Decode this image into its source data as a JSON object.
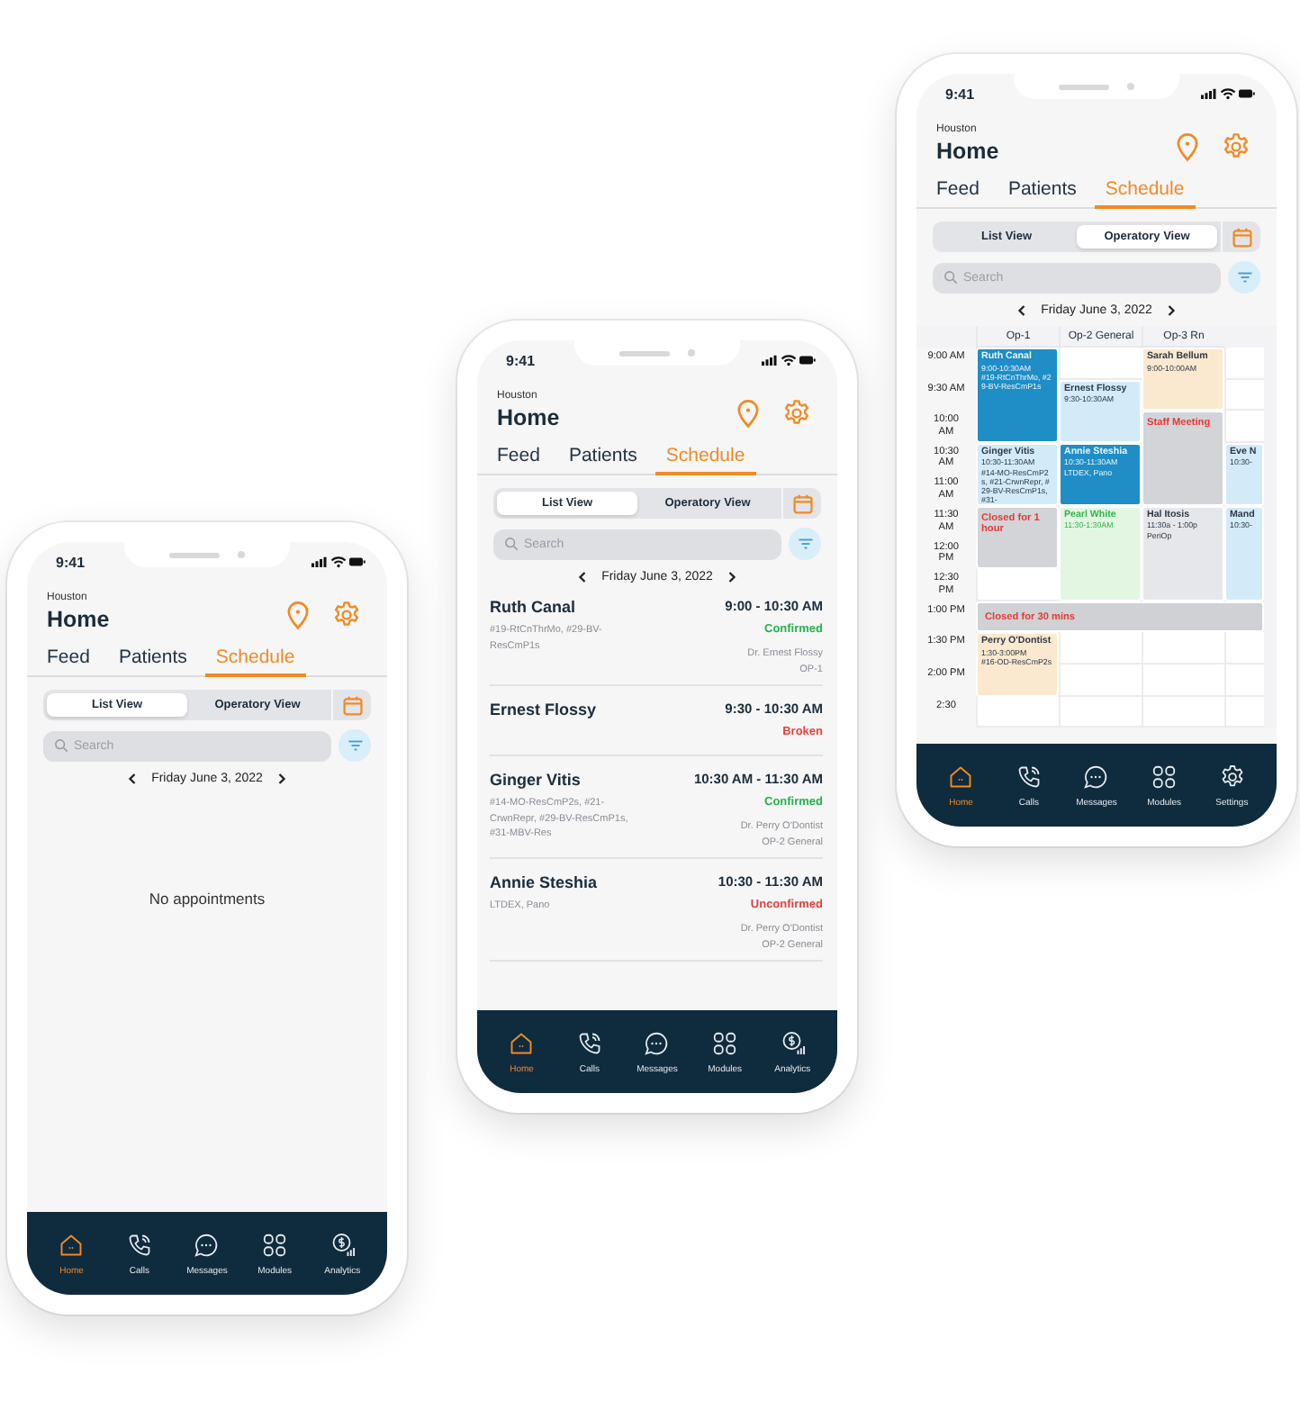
{
  "phones": [
    {
      "status_time": "9:41",
      "location": "Houston",
      "title": "Home",
      "tabs": [
        {
          "label": "Feed",
          "selected": false
        },
        {
          "label": "Patients",
          "selected": false
        },
        {
          "label": "Schedule",
          "selected": true
        }
      ],
      "views": [
        {
          "label": "List View",
          "selected": true
        },
        {
          "label": "Operatory View",
          "selected": false
        }
      ],
      "search": {
        "placeholder": "Search"
      },
      "date": "Friday June 3, 2022",
      "content": {
        "kind": "empty",
        "message": "No appointments"
      },
      "nav": [
        {
          "label": "Home",
          "kind": "home",
          "selected": true
        },
        {
          "label": "Calls",
          "kind": "calls",
          "selected": false
        },
        {
          "label": "Messages",
          "kind": "messages",
          "selected": false
        },
        {
          "label": "Modules",
          "kind": "modules",
          "selected": false
        },
        {
          "label": "Analytics",
          "kind": "analytics",
          "selected": false
        }
      ]
    },
    {
      "status_time": "9:41",
      "location": "Houston",
      "title": "Home",
      "tabs": [
        {
          "label": "Feed",
          "selected": false
        },
        {
          "label": "Patients",
          "selected": false
        },
        {
          "label": "Schedule",
          "selected": true
        }
      ],
      "views": [
        {
          "label": "List View",
          "selected": true
        },
        {
          "label": "Operatory View",
          "selected": false
        }
      ],
      "search": {
        "placeholder": "Search"
      },
      "date": "Friday June 3, 2022",
      "content": {
        "kind": "list",
        "appointments": [
          {
            "name": "Ruth Canal",
            "time": "9:00 - 10:30 AM",
            "details": "#19-RtCnThrMo, #29-BV-ResCmP1s",
            "status": "Confirmed",
            "color": "#22b34a",
            "provider": "Dr. Ernest Flossy",
            "op": "OP-1"
          },
          {
            "name": "Ernest Flossy",
            "time": "9:30 - 10:30 AM",
            "status": "Broken",
            "color": "#e5413a"
          },
          {
            "name": "Ginger Vitis",
            "time": "10:30 AM - 11:30 AM",
            "details": "#14-MO-ResCmP2s, #21-CrwnRepr, #29-BV-ResCmP1s, #31-MBV-Res",
            "status": "Confirmed",
            "color": "#22b34a",
            "provider": "Dr. Perry O'Dontist",
            "op": "OP-2 General"
          },
          {
            "name": "Annie Steshia",
            "time": "10:30 - 11:30 AM",
            "details": "LTDEX, Pano",
            "status": "Unconfirmed",
            "color": "#e5413a",
            "provider": "Dr. Perry O'Dontist",
            "op": "OP-2 General"
          }
        ]
      },
      "nav": [
        {
          "label": "Home",
          "kind": "home",
          "selected": true
        },
        {
          "label": "Calls",
          "kind": "calls",
          "selected": false
        },
        {
          "label": "Messages",
          "kind": "messages",
          "selected": false
        },
        {
          "label": "Modules",
          "kind": "modules",
          "selected": false
        },
        {
          "label": "Analytics",
          "kind": "analytics",
          "selected": false
        }
      ]
    },
    {
      "status_time": "9:41",
      "location": "Houston",
      "title": "Home",
      "tabs": [
        {
          "label": "Feed",
          "selected": false
        },
        {
          "label": "Patients",
          "selected": false
        },
        {
          "label": "Schedule",
          "selected": true
        }
      ],
      "views": [
        {
          "label": "List View",
          "selected": false
        },
        {
          "label": "Operatory View",
          "selected": true
        }
      ],
      "search": {
        "placeholder": "Search"
      },
      "date": "Friday June 3, 2022",
      "content": {
        "kind": "grid",
        "columns": [
          "Op-1",
          "Op-2 General",
          "Op-3 Rn"
        ],
        "rows": [
          {
            "time": "9:00 AM",
            "cells": [
              {
                "kind": "highlighted",
                "color": "#1f8dc6",
                "name": "Ruth Canal",
                "time": "9:00-10:30AM",
                "details": "#19-RtCnThrMo, #29-BV-ResCmP1s"
              },
              {
                "kind": "empty"
              },
              {
                "kind": "appointment",
                "color": "#fbe9cf",
                "name": "Sarah Bellum",
                "time": "9:00-10:00AM"
              },
              {
                "kind": "empty"
              }
            ]
          },
          {
            "time": "9:30 AM",
            "cells": [
              {
                "kind": "continued"
              },
              {
                "kind": "appointment",
                "color": "#d3ebf8",
                "name": "Ernest Flossy",
                "time": "9:30-10:30AM"
              },
              {
                "kind": "continued"
              },
              {
                "kind": "empty"
              }
            ]
          },
          {
            "time": "10:00 AM",
            "cells": [
              {
                "kind": "continued"
              },
              {
                "kind": "continued"
              },
              {
                "kind": "closed",
                "color": "#d2d4d8",
                "name": "Staff Meeting"
              },
              {
                "kind": "empty"
              }
            ]
          },
          {
            "time": "10:30 AM",
            "cells": [
              {
                "kind": "appointment",
                "color": "#d3ebf8",
                "name": "Ginger Vitis",
                "time": "10:30-11:30AM",
                "details": "#14-MO-ResCmP2s, #21-CrwnRepr, #29-BV-ResCmP1s, #31-"
              },
              {
                "kind": "highlighted",
                "color": "#1f8dc6",
                "name": "Annie Steshia",
                "time": "10:30-11:30AM",
                "details": "LTDEX, Pano"
              },
              {
                "kind": "continued"
              },
              {
                "kind": "appointment",
                "color": "#d3ebf8",
                "name": "Eve N",
                "time": "10:30-"
              }
            ]
          },
          {
            "time": "11:00 AM",
            "cells": [
              {
                "kind": "continued"
              },
              {
                "kind": "continued"
              },
              {
                "kind": "continued"
              },
              {
                "kind": "continued"
              }
            ]
          },
          {
            "time": "11:30 AM",
            "cells": [
              {
                "kind": "closed",
                "color": "#d2d4d8",
                "name": "Closed for 1 hour"
              },
              {
                "kind": "new",
                "color": "#e2f6e2",
                "name": "Pearl White",
                "time": "11:30-1:30AM"
              },
              {
                "kind": "appointment",
                "color": "#e6e7ea",
                "name": "Hal Itosis",
                "time": "11:30a - 1:00p",
                "details": "PeriOp"
              },
              {
                "kind": "appointment",
                "color": "#d3ebf8",
                "name": "Mand",
                "time": "10:30-"
              }
            ]
          },
          {
            "time": "12:00 PM",
            "cells": [
              {
                "kind": "continued"
              },
              {
                "kind": "continued"
              },
              {
                "kind": "continued"
              },
              {
                "kind": "continued"
              }
            ]
          },
          {
            "time": "12:30 PM",
            "cells": [
              {
                "kind": "empty"
              },
              {
                "kind": "continued"
              },
              {
                "kind": "continued"
              },
              {
                "kind": "continued"
              }
            ]
          },
          {
            "time": "1:00 PM",
            "cells": [
              {
                "kind": "closed",
                "color": "#cfd1d5",
                "name": "Closed for 30 mins",
                "across": true
              }
            ]
          },
          {
            "time": "1:30 PM",
            "cells": [
              {
                "kind": "appointment",
                "color": "#fbe9cf",
                "name": "Perry O'Dontist",
                "time": "1:30-3:00PM",
                "details": "#16-OD-ResCmP2s"
              },
              {
                "kind": "empty"
              },
              {
                "kind": "empty"
              },
              {
                "kind": "empty"
              }
            ]
          },
          {
            "time": "2:00 PM",
            "cells": [
              {
                "kind": "continued"
              },
              {
                "kind": "empty"
              },
              {
                "kind": "empty"
              },
              {
                "kind": "empty"
              }
            ]
          },
          {
            "time": "2:30",
            "cells": [
              {
                "kind": "empty"
              },
              {
                "kind": "empty"
              },
              {
                "kind": "empty"
              },
              {
                "kind": "empty"
              }
            ]
          }
        ]
      },
      "nav": [
        {
          "label": "Home",
          "kind": "home",
          "selected": true
        },
        {
          "label": "Calls",
          "kind": "calls",
          "selected": false
        },
        {
          "label": "Messages",
          "kind": "messages",
          "selected": false
        },
        {
          "label": "Modules",
          "kind": "modules",
          "selected": false
        },
        {
          "label": "Settings",
          "kind": "settings",
          "selected": false
        }
      ]
    }
  ]
}
